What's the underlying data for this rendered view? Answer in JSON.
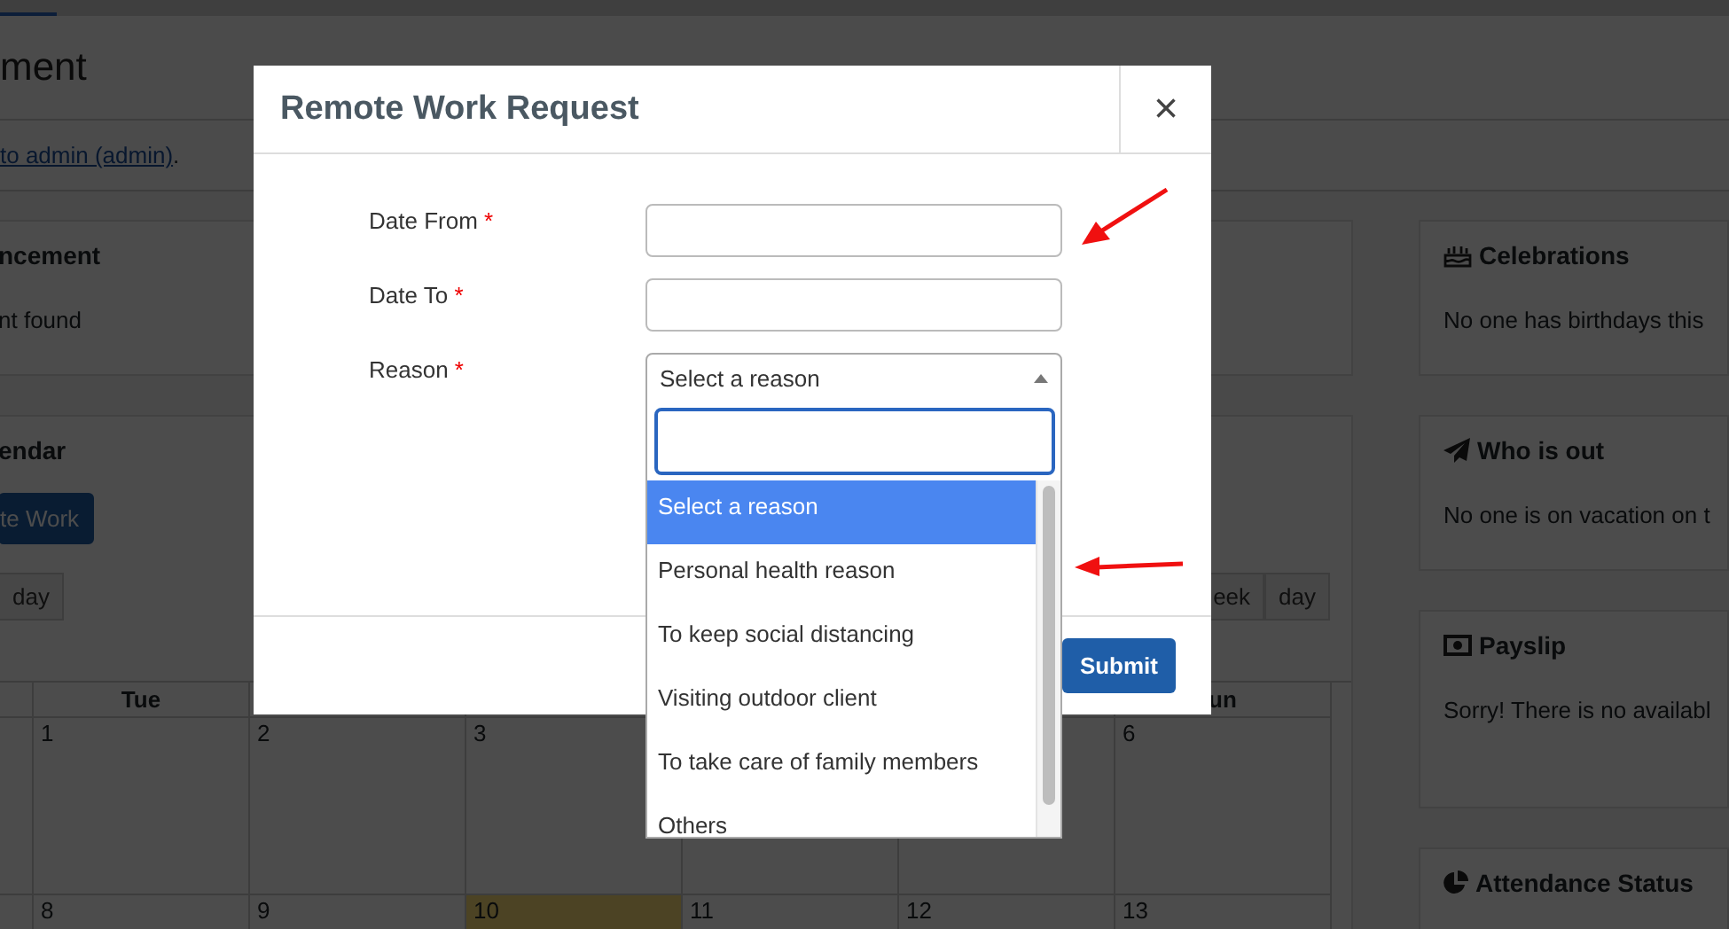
{
  "page": {
    "title": "ment",
    "notice_link": "to admin (admin)",
    "notice_end": "."
  },
  "announcement": {
    "title": "ncement",
    "text": "nt found"
  },
  "calendar": {
    "title": "endar",
    "add_button": "te Work",
    "view_left": "day",
    "views": [
      "eek",
      "day"
    ],
    "headers": [
      "Tue",
      "un"
    ],
    "weeks": [
      [
        {
          "day": "1",
          "today": false
        },
        {
          "day": "2",
          "today": false
        },
        {
          "day": "3",
          "today": false
        },
        {
          "today": false
        },
        {
          "today": false
        },
        {
          "day": "6",
          "today": false
        }
      ],
      [
        {
          "day": "8",
          "today": false
        },
        {
          "day": "9",
          "today": false
        },
        {
          "day": "10",
          "today": true
        },
        {
          "day": "11",
          "today": false
        },
        {
          "day": "12",
          "today": false
        },
        {
          "day": "13",
          "today": false
        }
      ]
    ]
  },
  "widgets": [
    {
      "kind": "cake",
      "title": "Celebrations",
      "text": "No one has birthdays this"
    },
    {
      "kind": "plane",
      "title": "Who is out",
      "text": "No one is on vacation on t"
    },
    {
      "kind": "money",
      "title": "Payslip",
      "text": "Sorry! There is no availabl"
    },
    {
      "kind": "pie",
      "title": "Attendance Status"
    }
  ],
  "modal": {
    "title": "Remote Work Request",
    "close": "×",
    "fields": [
      {
        "label": "Date From",
        "required_mark": "*",
        "kind": "text"
      },
      {
        "label": "Date To",
        "required_mark": "*",
        "kind": "text"
      },
      {
        "label": "Reason",
        "required_mark": "*",
        "kind": "select",
        "value": "Select a reason",
        "expanded": true
      }
    ],
    "options": [
      {
        "label": "Select a reason",
        "selected": true
      },
      {
        "label": "Personal health reason",
        "selected": false
      },
      {
        "label": "To keep social distancing",
        "selected": false
      },
      {
        "label": "Visiting outdoor client",
        "selected": false
      },
      {
        "label": "To take care of family members",
        "selected": false
      },
      {
        "label": "Others",
        "selected": false
      }
    ],
    "submit": "Submit"
  }
}
